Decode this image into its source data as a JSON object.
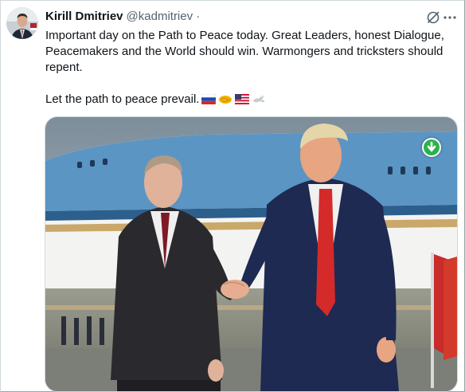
{
  "post": {
    "author_name": "Kirill Dmitriev",
    "author_handle": "@kadmitriev",
    "separator": "·",
    "paragraph_1": "Important day on the Path to Peace today. Great Leaders, honest Dialogue, Peacemakers and the World should win. Warmongers and tricksters should repent.",
    "paragraph_2": "Let the path to peace prevail."
  },
  "icons": {
    "flags": [
      "russia-flag-icon",
      "handshake-icon",
      "usa-flag-icon",
      "dove-icon"
    ],
    "grok": "grok-icon",
    "more": "more-icon",
    "download": "download-arrow-icon"
  },
  "colors": {
    "download_badge": "#2bb24c",
    "handle": "#536471",
    "text": "#0f1419"
  }
}
